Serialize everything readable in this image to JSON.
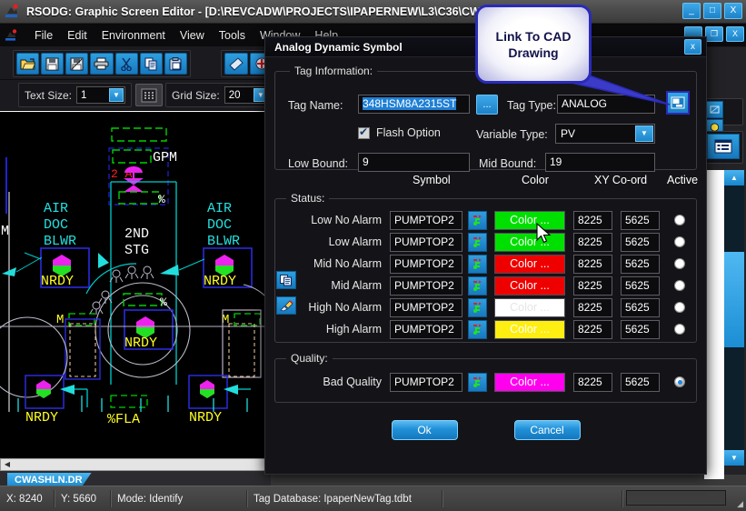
{
  "window": {
    "title": "RSODG: Graphic Screen Editor - [D:\\REVCADW\\PROJECTS\\IPAPERNEW\\L3\\C36\\CWASHLN.",
    "minimize": "_",
    "maximize": "□",
    "close": "X"
  },
  "mdi": {
    "minimize": "_",
    "restore": "❐",
    "close": "X"
  },
  "menu": {
    "items": [
      {
        "label": "File"
      },
      {
        "label": "Edit"
      },
      {
        "label": "Environment"
      },
      {
        "label": "View"
      },
      {
        "label": "Tools"
      },
      {
        "label": "Window"
      },
      {
        "label": "Help"
      }
    ]
  },
  "toolbar": {
    "buttons": [
      {
        "name": "open-icon",
        "glyph": "📂"
      },
      {
        "name": "save-icon",
        "glyph": "💾"
      },
      {
        "name": "save-as-icon",
        "glyph": "🖫"
      },
      {
        "name": "print-icon",
        "glyph": "🖨"
      },
      {
        "name": "cut-icon",
        "glyph": "✂"
      },
      {
        "name": "copy-icon",
        "glyph": "⧉"
      },
      {
        "name": "paste-icon",
        "glyph": "📋"
      }
    ],
    "buttons2": [
      {
        "name": "eraser-icon",
        "glyph": "🖌"
      },
      {
        "name": "add-point-icon",
        "glyph": "✛"
      }
    ],
    "text_size_label": "Text Size:",
    "text_size_value": "1",
    "grid_size_label": "Grid Size:",
    "grid_size_value": "20",
    "grid_toggle_icon": "grid-icon"
  },
  "right_panel": {
    "buttons": [
      {
        "name": "shape-tool-icon",
        "glyph": "▱"
      },
      {
        "name": "lamp-tool-icon",
        "glyph": "●"
      },
      {
        "name": "list-panel-icon",
        "glyph": "▤"
      }
    ]
  },
  "cad": {
    "tab_label": "CWASHLN.DR",
    "labels": [
      "M",
      "GPM",
      "2 A",
      "%",
      "AIR",
      "DOC",
      "BLWR",
      "2ND",
      "STG",
      "NRDY",
      "AIR",
      "DOC",
      "BLWR",
      "NRDY",
      "M",
      "NRDY",
      "M",
      "%",
      "%FLA"
    ]
  },
  "scrollbar": {
    "up_arrow": "▲",
    "down_arrow": "▼",
    "left_arrow": "◀"
  },
  "statusbar": {
    "x_coord": "X: 8240",
    "y_coord": "Y: 5660",
    "mode": "Mode: Identify",
    "tag_database": "Tag Database: IpaperNewTag.tdbt"
  },
  "callout": {
    "line1": "Link To CAD",
    "line2": "Drawing"
  },
  "dialog": {
    "title": "Analog Dynamic Symbol",
    "close": "x",
    "tag_info": {
      "legend": "Tag Information:",
      "tag_name_label": "Tag Name:",
      "tag_name_value": "348HSM8A2315ST",
      "browse_label": "...",
      "tag_type_label": "Tag Type:",
      "tag_type_value": "ANALOG",
      "link_cad_icon": "link-to-cad-icon",
      "flash_option_label": "Flash Option",
      "flash_option_checked": true,
      "variable_type_label": "Variable Type:",
      "variable_type_value": "PV",
      "low_bound_label": "Low Bound:",
      "low_bound_value": "9",
      "mid_bound_label": "Mid Bound:",
      "mid_bound_value": "19"
    },
    "columns": {
      "symbol": "Symbol",
      "color": "Color",
      "xy": "XY Co-ord",
      "active": "Active"
    },
    "status": {
      "legend": "Status:",
      "side_icons": [
        {
          "name": "copy-rows-icon",
          "glyph": "⧉"
        },
        {
          "name": "paint-rows-icon",
          "glyph": "🖌"
        }
      ],
      "rows": [
        {
          "label": "Low No Alarm",
          "symbol": "PUMPTOP2",
          "color_label": "Color ...",
          "color": "#00e000",
          "text_color": "#ffffff",
          "x": "8225",
          "y": "5625",
          "active": false
        },
        {
          "label": "Low Alarm",
          "symbol": "PUMPTOP2",
          "color_label": "Color ...",
          "color": "#00e000",
          "text_color": "#ffffff",
          "x": "8225",
          "y": "5625",
          "active": false
        },
        {
          "label": "Mid No Alarm",
          "symbol": "PUMPTOP2",
          "color_label": "Color ...",
          "color": "#ee0000",
          "text_color": "#ffffff",
          "x": "8225",
          "y": "5625",
          "active": false
        },
        {
          "label": "Mid Alarm",
          "symbol": "PUMPTOP2",
          "color_label": "Color ...",
          "color": "#ee0000",
          "text_color": "#ffffff",
          "x": "8225",
          "y": "5625",
          "active": false
        },
        {
          "label": "High No Alarm",
          "symbol": "PUMPTOP2",
          "color_label": "Color ...",
          "color": "#ffffff",
          "text_color": "#e6e6e6",
          "x": "8225",
          "y": "5625",
          "active": false
        },
        {
          "label": "High Alarm",
          "symbol": "PUMPTOP2",
          "color_label": "Color ...",
          "color": "#ffee11",
          "text_color": "#ffffff",
          "x": "8225",
          "y": "5625",
          "active": false
        }
      ]
    },
    "quality": {
      "legend": "Quality:",
      "rows": [
        {
          "label": "Bad Quality",
          "symbol": "PUMPTOP2",
          "color_label": "Color ...",
          "color": "#ff00ee",
          "text_color": "#ffffff",
          "x": "8225",
          "y": "5625",
          "active": true
        }
      ]
    },
    "ok_label": "Ok",
    "cancel_label": "Cancel"
  }
}
